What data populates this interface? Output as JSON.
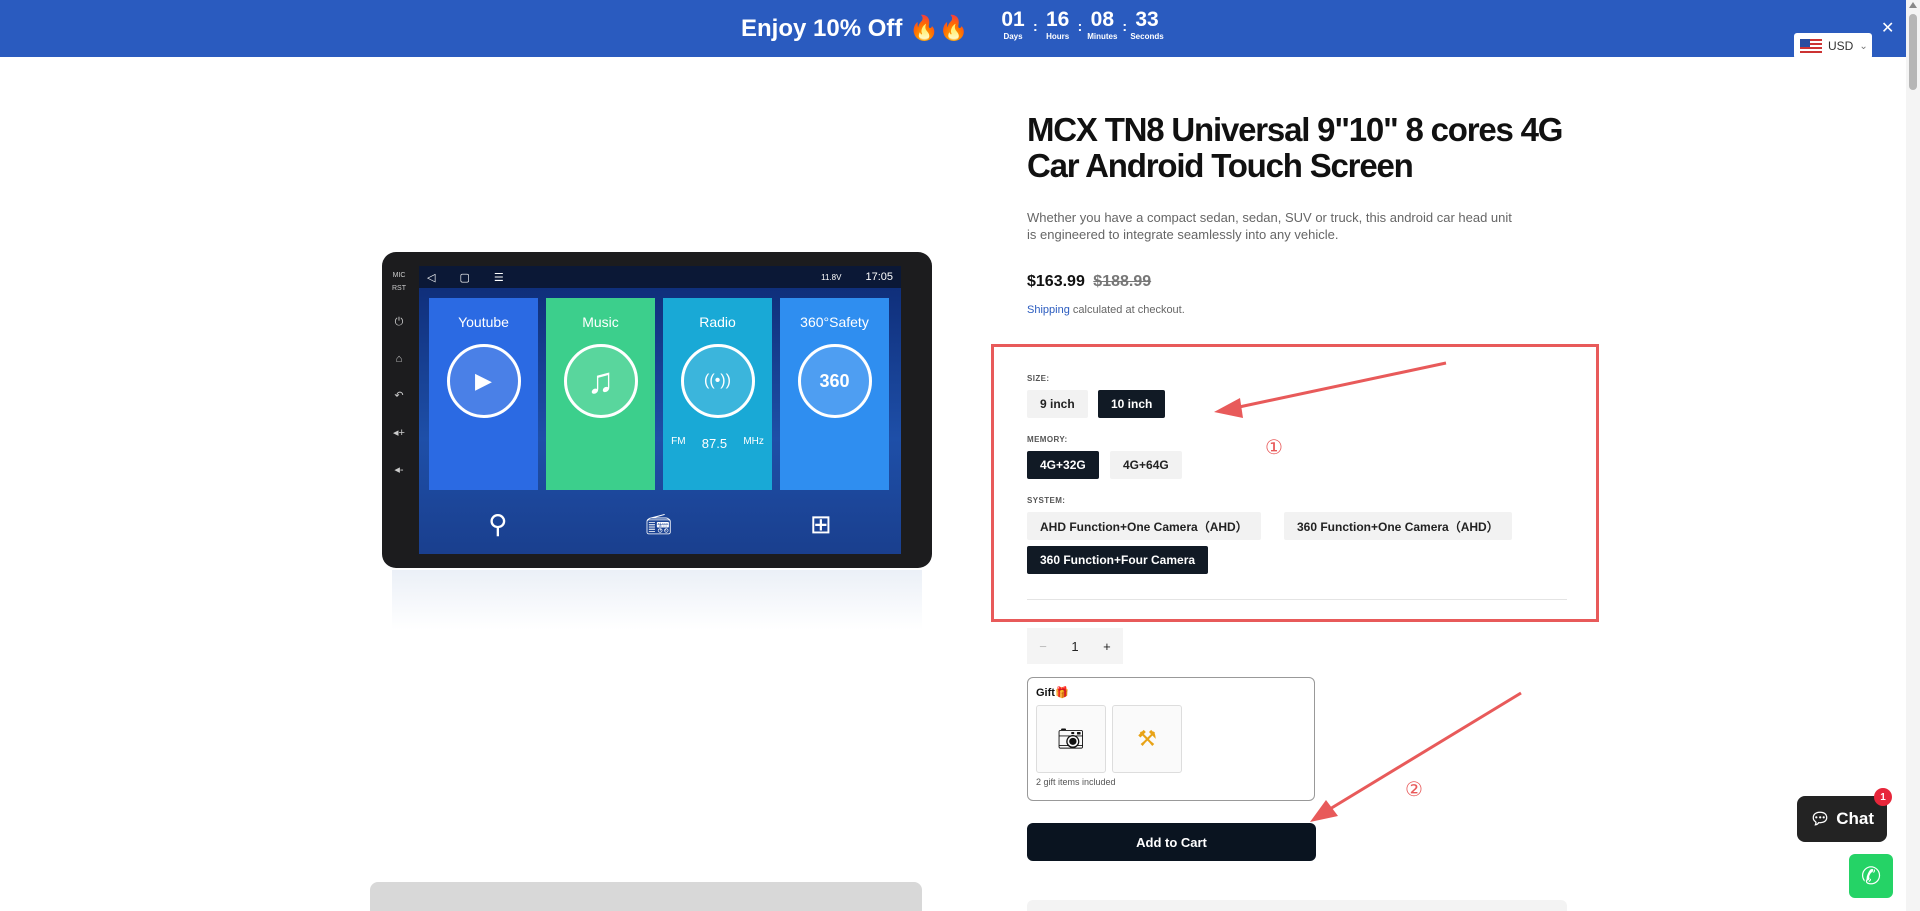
{
  "promo": {
    "text": "Enjoy 10% Off 🔥🔥",
    "countdown": [
      {
        "value": "01",
        "label": "Days"
      },
      {
        "value": "16",
        "label": "Hours"
      },
      {
        "value": "08",
        "label": "Minutes"
      },
      {
        "value": "33",
        "label": "Seconds"
      }
    ],
    "currency": "USD",
    "close": "✕"
  },
  "device": {
    "side_labels": [
      "MIC",
      "RST",
      "⏻",
      "⌂",
      "↶",
      "◂+",
      "◂-"
    ],
    "status_time": "17:05",
    "status_voltage": "11.8V",
    "tiles": [
      {
        "label": "Youtube",
        "icon": "▶",
        "color": "#2b6ae3"
      },
      {
        "label": "Music",
        "icon": "♫",
        "color": "#3ccf8c"
      },
      {
        "label": "Radio",
        "icon": "((•))",
        "color": "#19a9d6"
      },
      {
        "label": "360°Safety",
        "icon": "360",
        "color": "#2f8ef0"
      }
    ],
    "radio_band": "FM",
    "radio_freq": "87.5",
    "radio_unit": "MHz",
    "dock_icons": [
      "location-pin-icon",
      "radio-icon",
      "apps-grid-icon"
    ]
  },
  "product": {
    "title": "MCX TN8 Universal 9\"10\" 8 cores 4G Car Android Touch Screen",
    "description": "Whether you have a compact sedan, sedan, SUV or truck, this android car head unit is engineered to integrate seamlessly into any vehicle.",
    "price": "$163.99",
    "compare_price": "$188.99",
    "shipping_link": "Shipping",
    "shipping_text": " calculated at checkout."
  },
  "options": {
    "size_label": "SIZE:",
    "size": [
      "9 inch",
      "10 inch"
    ],
    "memory_label": "MEMORY:",
    "memory": [
      "4G+32G",
      "4G+64G"
    ],
    "system_label": "SYSTEM:",
    "system": [
      "AHD Function+One Camera（AHD）",
      "360 Function+One Camera（AHD）",
      "360 Function+Four Camera"
    ]
  },
  "annotations": {
    "marker_1": "①",
    "marker_2": "②",
    "color": "#e85a5a"
  },
  "quantity": {
    "minus": "−",
    "value": "1",
    "plus": "+"
  },
  "gift": {
    "title": "Gift🎁",
    "note": "2 gift items included"
  },
  "cart": {
    "label": "Add to Cart"
  },
  "chat": {
    "label": "Chat",
    "badge": "1"
  }
}
